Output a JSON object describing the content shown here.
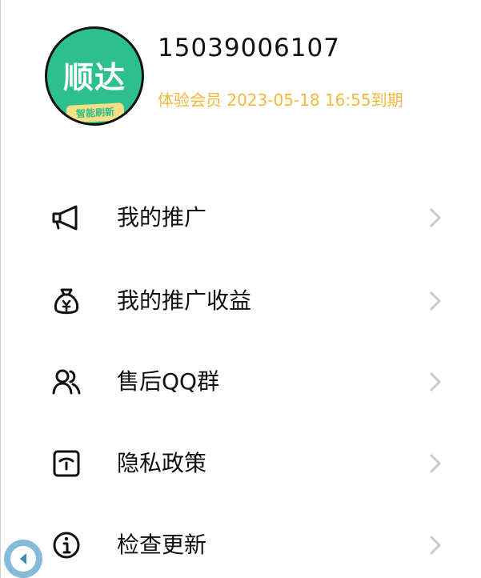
{
  "profile": {
    "logo_text": "顺达",
    "logo_subtext": "智能刷新",
    "phone": "15039006107",
    "membership": "体验会员 2023-05-18 16:55到期"
  },
  "menu": {
    "items": [
      {
        "label": "我的推广",
        "icon": "megaphone-icon"
      },
      {
        "label": "我的推广收益",
        "icon": "money-bag-icon"
      },
      {
        "label": "售后QQ群",
        "icon": "users-icon"
      },
      {
        "label": "隐私政策",
        "icon": "privacy-icon"
      },
      {
        "label": "检查更新",
        "icon": "info-icon"
      }
    ]
  },
  "colors": {
    "accent_orange": "#f5b83f",
    "logo_green": "#2dbf8e",
    "floating_button": "#7fb8d8"
  }
}
